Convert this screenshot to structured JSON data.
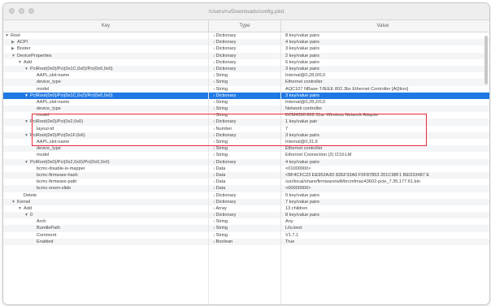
{
  "window": {
    "title": "/Users/ru/Downloads/config.plist"
  },
  "columns": {
    "key": "Key",
    "type": "Type",
    "value": "Value"
  },
  "rows": [
    {
      "depth": 0,
      "disclosure": "down",
      "key": "Root",
      "type": "Dictionary",
      "value": "8 key/value pairs",
      "selected": false
    },
    {
      "depth": 1,
      "disclosure": "right",
      "key": "ACPI",
      "type": "Dictionary",
      "value": "4 key/value pairs",
      "selected": false
    },
    {
      "depth": 1,
      "disclosure": "right",
      "key": "Booter",
      "type": "Dictionary",
      "value": "3 key/value pairs",
      "selected": false
    },
    {
      "depth": 1,
      "disclosure": "down",
      "key": "DeviceProperties",
      "type": "Dictionary",
      "value": "2 key/value pairs",
      "selected": false
    },
    {
      "depth": 2,
      "disclosure": "down",
      "key": "Add",
      "type": "Dictionary",
      "value": "5 key/value pairs",
      "selected": false
    },
    {
      "depth": 3,
      "disclosure": "down",
      "key": "PciRoot(0x0)/Pci(0x1C,0x0)/Pci(0x0,0x0)",
      "type": "Dictionary",
      "value": "3 key/value pairs",
      "selected": false
    },
    {
      "depth": 4,
      "disclosure": "",
      "key": "AAPL,slot-name",
      "type": "String",
      "value": "Internal@0,28,0/0,0",
      "selected": false
    },
    {
      "depth": 4,
      "disclosure": "",
      "key": "device_type",
      "type": "String",
      "value": "Ethernet controller",
      "selected": false
    },
    {
      "depth": 4,
      "disclosure": "",
      "key": "model",
      "type": "String",
      "value": "AQC107 NBase-T/IEEE 802.3bz Ethernet Controller [AQtion]",
      "selected": false
    },
    {
      "depth": 3,
      "disclosure": "down",
      "key": "PciRoot(0x0)/Pci(0x1C,0x2)/Pci(0x0,0x0)",
      "type": "Dictionary",
      "value": "3 key/value pairs",
      "selected": true
    },
    {
      "depth": 4,
      "disclosure": "",
      "key": "AAPL,slot-name",
      "type": "String",
      "value": "Internal@0,28,2/0,0",
      "selected": false
    },
    {
      "depth": 4,
      "disclosure": "",
      "key": "device_type",
      "type": "String",
      "value": "Network controller",
      "selected": false
    },
    {
      "depth": 4,
      "disclosure": "",
      "key": "model",
      "type": "String",
      "value": "BCM4360 802.11ac Wireless Network Adapter",
      "selected": false
    },
    {
      "depth": 3,
      "disclosure": "down",
      "key": "PciRoot(0x0)/Pci(0x2,0x0)",
      "type": "Dictionary",
      "value": "1 key/value pair",
      "selected": false
    },
    {
      "depth": 4,
      "disclosure": "",
      "key": "layout-id",
      "type": "Number",
      "value": "7",
      "selected": false
    },
    {
      "depth": 3,
      "disclosure": "down",
      "key": "PciRoot(0x0)/Pci(0x1F,0x6)",
      "type": "Dictionary",
      "value": "3 key/value pairs",
      "selected": false
    },
    {
      "depth": 4,
      "disclosure": "",
      "key": "AAPL,slot-name",
      "type": "String",
      "value": "Internal@0,31,6",
      "selected": false
    },
    {
      "depth": 4,
      "disclosure": "",
      "key": "device_type",
      "type": "String",
      "value": "Ethernet controller",
      "selected": false
    },
    {
      "depth": 4,
      "disclosure": "",
      "key": "model",
      "type": "String",
      "value": "Ethernet Connection (2) I219-LM",
      "selected": false
    },
    {
      "depth": 3,
      "disclosure": "down",
      "key": "PciRoot(0x0)/Pci(0x2,0x0)/Pci(0x0,0x0)",
      "type": "Dictionary",
      "value": "4 key/value pairs",
      "selected": false
    },
    {
      "depth": 4,
      "disclosure": "",
      "key": "bcmc-disable-ix-mapper",
      "type": "Data",
      "value": "<01000000>",
      "selected": false
    },
    {
      "depth": 4,
      "disclosure": "",
      "key": "bcmc-firmware-hash",
      "type": "Data",
      "value": "<BF4CFC23 EE952A3D 82EF33A0 F5F87853 201C98F1 BED33487 E",
      "selected": false
    },
    {
      "depth": 4,
      "disclosure": "",
      "key": "bcmc-firmware-path",
      "type": "Data",
      "value": "/usr/local/share/firmware/wifi/brcmfmac43602-pcie_7.35.177.61.bin",
      "selected": false
    },
    {
      "depth": 4,
      "disclosure": "",
      "key": "bcmc-snom-slide",
      "type": "Data",
      "value": "<00000000>",
      "selected": false
    },
    {
      "depth": 2,
      "disclosure": "",
      "key": "Delete",
      "type": "Dictionary",
      "value": "0 key/value pairs",
      "selected": false
    },
    {
      "depth": 1,
      "disclosure": "down",
      "key": "Kernel",
      "type": "Dictionary",
      "value": "7 key/value pairs",
      "selected": false
    },
    {
      "depth": 2,
      "disclosure": "down",
      "key": "Add",
      "type": "Array",
      "value": "13 children",
      "selected": false
    },
    {
      "depth": 3,
      "disclosure": "down",
      "key": "0",
      "type": "Dictionary",
      "value": "8 key/value pairs",
      "selected": false
    },
    {
      "depth": 4,
      "disclosure": "",
      "key": "Arch",
      "type": "String",
      "value": "Any",
      "selected": false
    },
    {
      "depth": 4,
      "disclosure": "",
      "key": "BundlePath",
      "type": "String",
      "value": "Lilu.kext",
      "selected": false
    },
    {
      "depth": 4,
      "disclosure": "",
      "key": "Comment",
      "type": "String",
      "value": "V1.7.1",
      "selected": false
    },
    {
      "depth": 4,
      "disclosure": "",
      "key": "Enabled",
      "type": "Boolean",
      "value": "True",
      "selected": false
    }
  ]
}
